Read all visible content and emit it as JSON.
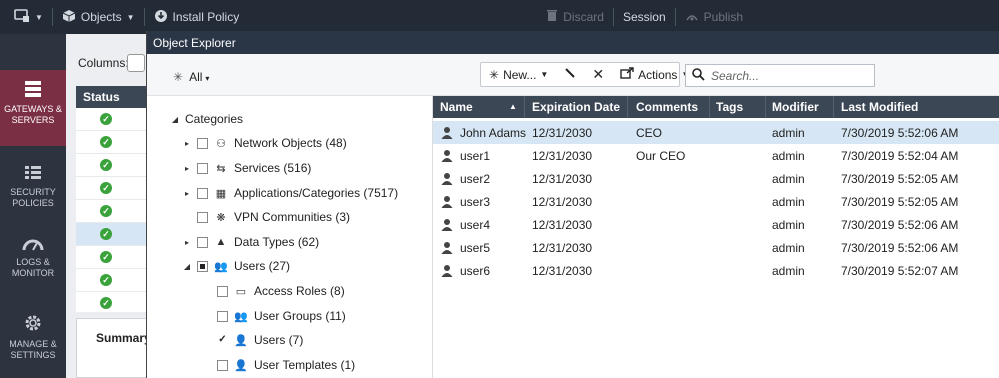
{
  "topbar": {
    "objects_label": "Objects",
    "install_policy_label": "Install Policy",
    "discard_label": "Discard",
    "session_label": "Session",
    "publish_label": "Publish"
  },
  "leftnav": {
    "items": [
      {
        "label": "GATEWAYS & SERVERS",
        "icon": "gateways-icon",
        "active": true
      },
      {
        "label": "SECURITY POLICIES",
        "icon": "policies-icon",
        "active": false
      },
      {
        "label": "LOGS & MONITOR",
        "icon": "gauge-icon",
        "active": false
      },
      {
        "label": "MANAGE & SETTINGS",
        "icon": "gear-icon",
        "active": false
      }
    ]
  },
  "background_panel": {
    "columns_label": "Columns:",
    "status_header": "Status",
    "summary_tab": "Summary",
    "status_rows": 9
  },
  "explorer": {
    "title": "Object Explorer",
    "filter_label": "All",
    "new_label": "New...",
    "actions_label": "Actions",
    "search_placeholder": "Search...",
    "categories_label": "Categories",
    "tree": [
      {
        "label": "Network Objects (48)",
        "icon": "network-icon",
        "expandable": true,
        "checked": "none"
      },
      {
        "label": "Services (516)",
        "icon": "services-icon",
        "expandable": true,
        "checked": "none"
      },
      {
        "label": "Applications/Categories (7517)",
        "icon": "apps-icon",
        "expandable": true,
        "checked": "none"
      },
      {
        "label": "VPN Communities (3)",
        "icon": "vpn-icon",
        "expandable": false,
        "checked": "none"
      },
      {
        "label": "Data Types (62)",
        "icon": "datatypes-icon",
        "expandable": true,
        "checked": "none"
      },
      {
        "label": "Users (27)",
        "icon": "users-group-icon",
        "expandable": true,
        "expanded": true,
        "checked": "partial"
      }
    ],
    "subtree": [
      {
        "label": "Access Roles (8)",
        "icon": "access-role-icon",
        "checked": "none"
      },
      {
        "label": "User Groups (11)",
        "icon": "user-groups-icon",
        "checked": "none"
      },
      {
        "label": "Users (7)",
        "icon": "user-icon",
        "checked": "checked"
      },
      {
        "label": "User Templates (1)",
        "icon": "user-template-icon",
        "checked": "none"
      }
    ],
    "grid": {
      "headers": [
        "Name",
        "Expiration Date",
        "Comments",
        "Tags",
        "Modifier",
        "Last Modified"
      ],
      "rows": [
        {
          "name": "John Adams",
          "expiration": "12/31/2030",
          "comments": "CEO",
          "tags": "",
          "modifier": "admin",
          "last_modified": "7/30/2019 5:52:06 AM",
          "selected": true
        },
        {
          "name": "user1",
          "expiration": "12/31/2030",
          "comments": "Our CEO",
          "tags": "",
          "modifier": "admin",
          "last_modified": "7/30/2019 5:52:04 AM"
        },
        {
          "name": "user2",
          "expiration": "12/31/2030",
          "comments": "",
          "tags": "",
          "modifier": "admin",
          "last_modified": "7/30/2019 5:52:05 AM"
        },
        {
          "name": "user3",
          "expiration": "12/31/2030",
          "comments": "",
          "tags": "",
          "modifier": "admin",
          "last_modified": "7/30/2019 5:52:05 AM"
        },
        {
          "name": "user4",
          "expiration": "12/31/2030",
          "comments": "",
          "tags": "",
          "modifier": "admin",
          "last_modified": "7/30/2019 5:52:06 AM"
        },
        {
          "name": "user5",
          "expiration": "12/31/2030",
          "comments": "",
          "tags": "",
          "modifier": "admin",
          "last_modified": "7/30/2019 5:52:06 AM"
        },
        {
          "name": "user6",
          "expiration": "12/31/2030",
          "comments": "",
          "tags": "",
          "modifier": "admin",
          "last_modified": "7/30/2019 5:52:07 AM"
        }
      ]
    }
  },
  "colors": {
    "accent_active_nav": "#7b2f45",
    "header_dark": "#3c4756",
    "selected_row": "#d6e6f4",
    "status_ok": "#3aa23a"
  }
}
